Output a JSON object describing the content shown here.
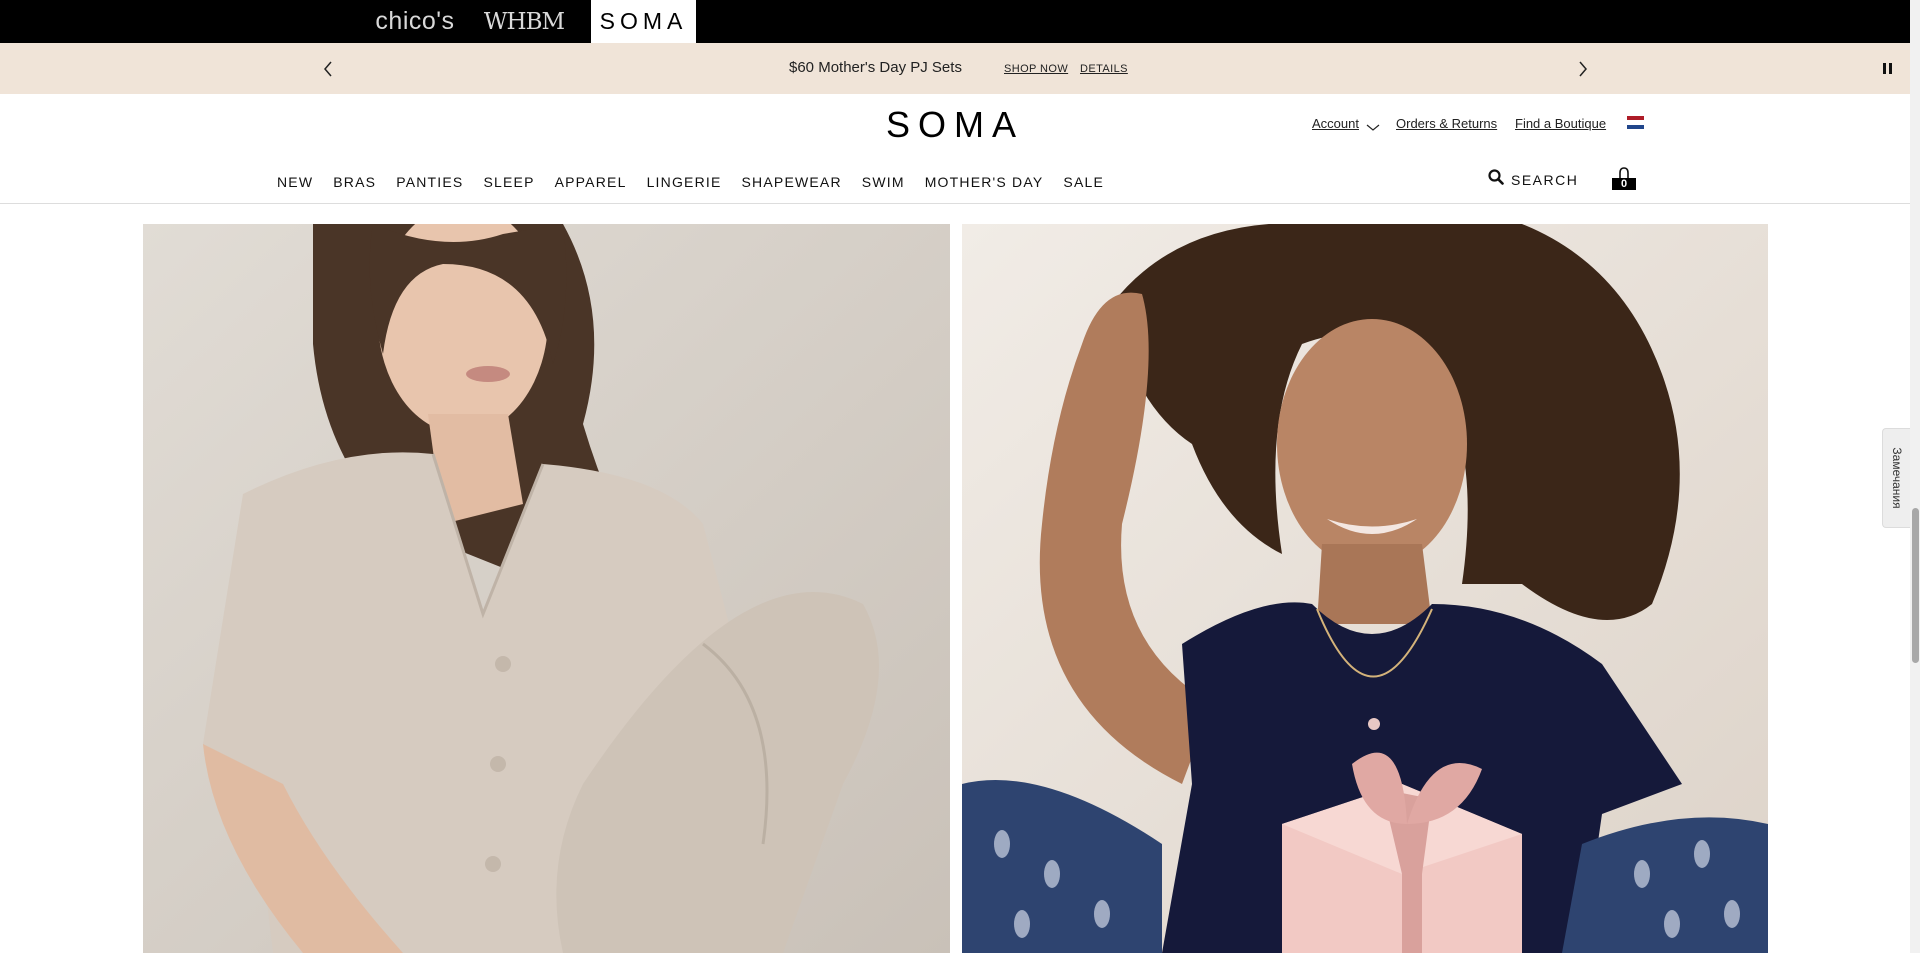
{
  "brands": {
    "chicos": "chico's",
    "whbm": "WHBM",
    "soma": "SOMA"
  },
  "promo": {
    "text": "$60 Mother's Day PJ Sets",
    "shop_now": "SHOP NOW",
    "details": "DETAILS",
    "prev_icon": "chevron-left-icon",
    "next_icon": "chevron-right-icon",
    "pause_icon": "pause-icon",
    "background": "#f0e4d8"
  },
  "header": {
    "logo": "SOMA",
    "account": "Account",
    "orders": "Orders & Returns",
    "boutique": "Find a Boutique",
    "flag_icon": "netherlands-flag-icon"
  },
  "nav": {
    "items": [
      "NEW",
      "BRAS",
      "PANTIES",
      "SLEEP",
      "APPAREL",
      "LINGERIE",
      "SHAPEWEAR",
      "SWIM",
      "MOTHER'S DAY",
      "SALE"
    ],
    "search": "SEARCH",
    "bag_count": "0"
  },
  "feedback": {
    "label": "Замечания"
  },
  "colors": {
    "brandbar": "#000000",
    "text": "#111111"
  }
}
